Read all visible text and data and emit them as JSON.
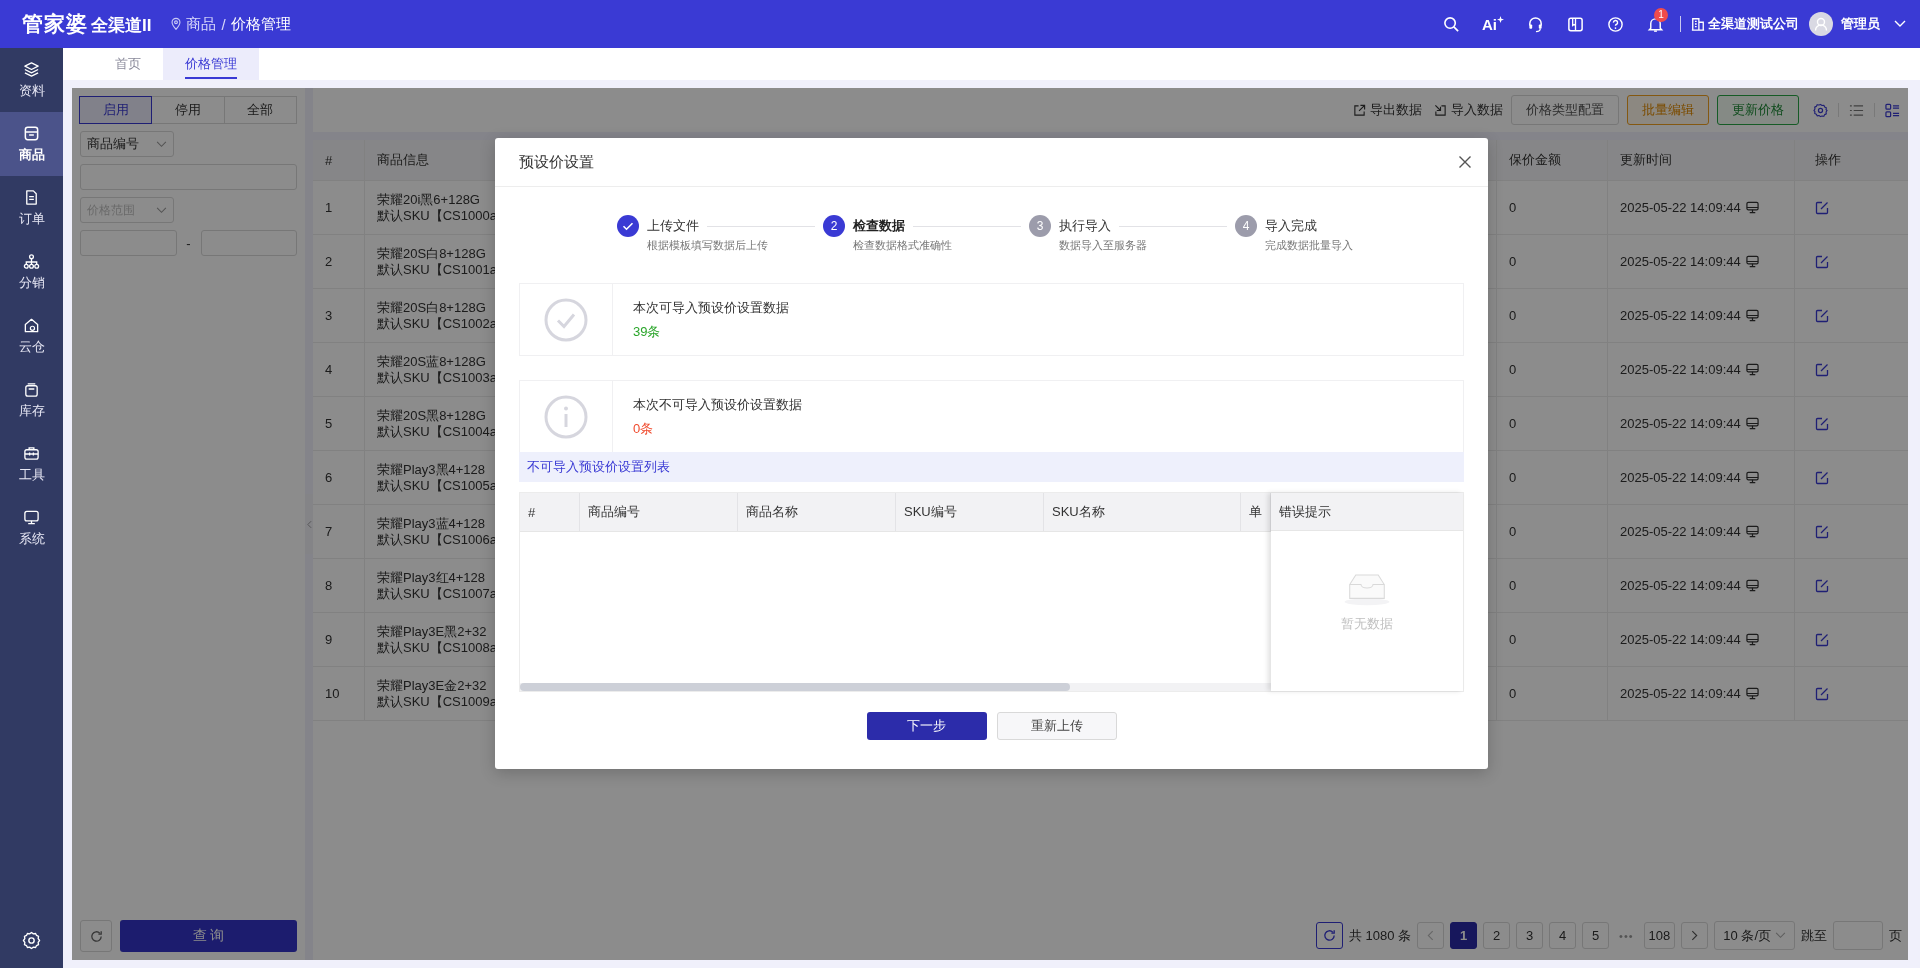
{
  "header": {
    "logo": "管家婆",
    "logo_suffix": "全渠道II",
    "breadcrumb": [
      "商品",
      "价格管理"
    ],
    "breadcrumb_separator": "/",
    "ai_label": "Ai",
    "notification_count": "1",
    "company": "全渠道测试公司",
    "user": "管理员"
  },
  "sidebar": {
    "items": [
      {
        "label": "资料",
        "selected": false
      },
      {
        "label": "商品",
        "selected": true
      },
      {
        "label": "订单",
        "selected": false
      },
      {
        "label": "分销",
        "selected": false
      },
      {
        "label": "云仓",
        "selected": false
      },
      {
        "label": "库存",
        "selected": false
      },
      {
        "label": "工具",
        "selected": false
      },
      {
        "label": "系统",
        "selected": false
      }
    ]
  },
  "tabs": [
    {
      "label": "首页",
      "selected": false
    },
    {
      "label": "价格管理",
      "selected": true
    }
  ],
  "filter": {
    "status_tabs": [
      {
        "label": "启用",
        "selected": true
      },
      {
        "label": "停用",
        "selected": false
      },
      {
        "label": "全部",
        "selected": false
      }
    ],
    "field_select": "商品编号",
    "range_select": "价格范围",
    "range_separator": "-",
    "query_button": "查 询"
  },
  "toolbar": {
    "links": [
      "导出数据",
      "导入数据"
    ],
    "buttons": [
      {
        "label": "价格类型配置",
        "kind": "default"
      },
      {
        "label": "批量编辑",
        "kind": "warning"
      },
      {
        "label": "更新价格",
        "kind": "success"
      }
    ]
  },
  "table": {
    "columns": [
      "#",
      "商品信息",
      "保价金额",
      "更新时间",
      "操作"
    ],
    "rows": [
      {
        "index": "1",
        "name": "荣耀20i黑6+128G",
        "sku": "默认SKU【CS1000a",
        "amount": "0",
        "updated": "2025-05-22 14:09:44"
      },
      {
        "index": "2",
        "name": "荣耀20S白8+128G",
        "sku": "默认SKU【CS1001a",
        "amount": "0",
        "updated": "2025-05-22 14:09:44"
      },
      {
        "index": "3",
        "name": "荣耀20S白8+128G",
        "sku": "默认SKU【CS1002a",
        "amount": "0",
        "updated": "2025-05-22 14:09:44"
      },
      {
        "index": "4",
        "name": "荣耀20S蓝8+128G",
        "sku": "默认SKU【CS1003a",
        "amount": "0",
        "updated": "2025-05-22 14:09:44"
      },
      {
        "index": "5",
        "name": "荣耀20S黑8+128G",
        "sku": "默认SKU【CS1004a",
        "amount": "0",
        "updated": "2025-05-22 14:09:44"
      },
      {
        "index": "6",
        "name": "荣耀Play3黑4+128",
        "sku": "默认SKU【CS1005a",
        "amount": "0",
        "updated": "2025-05-22 14:09:44"
      },
      {
        "index": "7",
        "name": "荣耀Play3蓝4+128",
        "sku": "默认SKU【CS1006a",
        "amount": "0",
        "updated": "2025-05-22 14:09:44"
      },
      {
        "index": "8",
        "name": "荣耀Play3红4+128",
        "sku": "默认SKU【CS1007a",
        "amount": "0",
        "updated": "2025-05-22 14:09:44"
      },
      {
        "index": "9",
        "name": "荣耀Play3E黑2+32",
        "sku": "默认SKU【CS1008a",
        "amount": "0",
        "updated": "2025-05-22 14:09:44"
      },
      {
        "index": "10",
        "name": "荣耀Play3E金2+32",
        "sku": "默认SKU【CS1009a",
        "amount": "0",
        "updated": "2025-05-22 14:09:44"
      }
    ]
  },
  "pagination": {
    "total": "共 1080 条",
    "pages": [
      {
        "label": "1",
        "selected": true
      },
      {
        "label": "2",
        "selected": false
      },
      {
        "label": "3",
        "selected": false
      },
      {
        "label": "4",
        "selected": false
      },
      {
        "label": "5",
        "selected": false
      }
    ],
    "ellipsis": "•••",
    "last_page": "108",
    "page_size": "10 条/页",
    "jump_label": "跳至",
    "page_suffix": "页"
  },
  "dialog": {
    "title": "预设价设置",
    "steps": [
      {
        "title": "上传文件",
        "description": "根据模板填写数据后上传",
        "done": true,
        "current": false
      },
      {
        "title": "检查数据",
        "description": "检查数据格式准确性",
        "done": false,
        "current": true,
        "number": "2"
      },
      {
        "title": "执行导入",
        "description": "数据导入至服务器",
        "done": false,
        "current": false,
        "number": "3"
      },
      {
        "title": "导入完成",
        "description": "完成数据批量导入",
        "done": false,
        "current": false,
        "number": "4"
      }
    ],
    "results": [
      {
        "kind": "success",
        "label": "本次可导入预设价设置数据",
        "count": "39条"
      },
      {
        "kind": "error",
        "label": "本次不可导入预设价设置数据",
        "count": "0条"
      }
    ],
    "error_list": {
      "title": "不可导入预设价设置列表",
      "columns": [
        "#",
        "商品编号",
        "商品名称",
        "SKU编号",
        "SKU名称",
        "单"
      ],
      "fixed_column": "错误提示",
      "empty_text": "暂无数据"
    },
    "buttons": [
      {
        "label": "下一步",
        "kind": "primary"
      },
      {
        "label": "重新上传",
        "kind": "default"
      }
    ]
  }
}
